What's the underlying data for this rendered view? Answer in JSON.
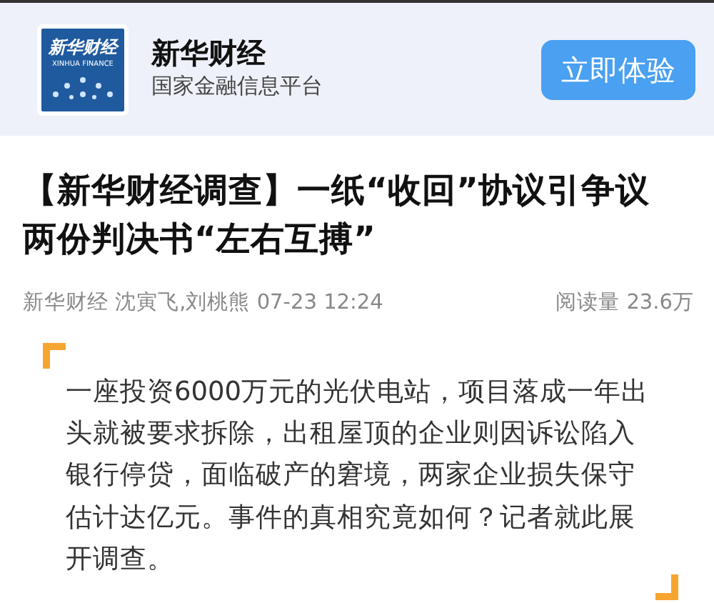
{
  "app_banner": {
    "logo": {
      "title": "新华财经",
      "subtitle": "XINHUA FINANCE"
    },
    "name": "新华财经",
    "tagline": "国家金融信息平台",
    "button": "立即体验"
  },
  "article": {
    "title": "【新华财经调查】一纸“收回”协议引争议两份判决书“左右互搏”",
    "source": "新华财经",
    "authors": "沈寅飞,刘桃熊",
    "time": "07-23 12:24",
    "reads": "阅读量 23.6万",
    "summary": "一座投资6000万元的光伏电站，项目落成一年出头就被要求拆除，出租屋顶的企业则因诉讼陷入银行停贷，面临破产的窘境，两家企业损失保守估计达亿元。事件的真相究竟如何？记者就此展开调查。"
  }
}
